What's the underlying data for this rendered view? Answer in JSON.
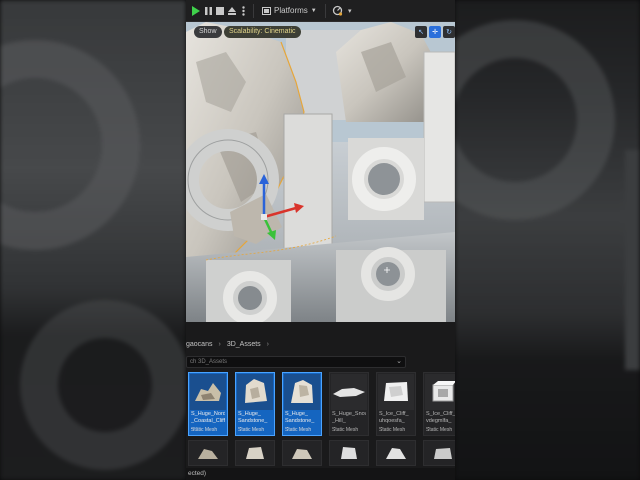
{
  "toolbar": {
    "platforms_label": "Platforms",
    "platforms_icon": "platforms-icon",
    "play_icon": "play-icon",
    "pause_icon": "pause-icon",
    "stop_icon": "stop-icon",
    "eject_icon": "eject-icon",
    "more_icon": "more-vertical-icon",
    "source_control_icon": "source-control-icon"
  },
  "viewport": {
    "show_label": "Show",
    "scalability_label": "Scalability: Cinematic",
    "icons": [
      "select-icon",
      "translate-icon",
      "rotate-icon"
    ]
  },
  "content_browser": {
    "breadcrumb": [
      "gaocans",
      "3D_Assets"
    ],
    "search_placeholder": "ch 3D_Assets",
    "assets": [
      {
        "name": "S_Huge_Nordic\n_Coastal_Cliff\n_...",
        "type": "Static Mesh",
        "selected": true
      },
      {
        "name": "S_Huge_\nSandstone_\n...",
        "type": "Static Mesh",
        "selected": true
      },
      {
        "name": "S_Huge_\nSandstone_\n...",
        "type": "Static Mesh",
        "selected": true
      },
      {
        "name": "S_Huge_Snow\n_Hill_\n...",
        "type": "Static Mesh",
        "selected": false
      },
      {
        "name": "S_Ice_Cliff_\nuhqoesfa_\n...",
        "type": "Static Mesh",
        "selected": false
      },
      {
        "name": "S_Ice_Cliff_\nvdegmlfa_\n...",
        "type": "Static Mesh",
        "selected": false
      }
    ],
    "status_text": "ected)"
  },
  "colors": {
    "accent": "#1565c0",
    "play": "#3fd14b",
    "gizmo_x": "#d9342b",
    "gizmo_y": "#39c23a",
    "gizmo_z": "#2a63d9",
    "selection_outline": "#e6a63a"
  }
}
